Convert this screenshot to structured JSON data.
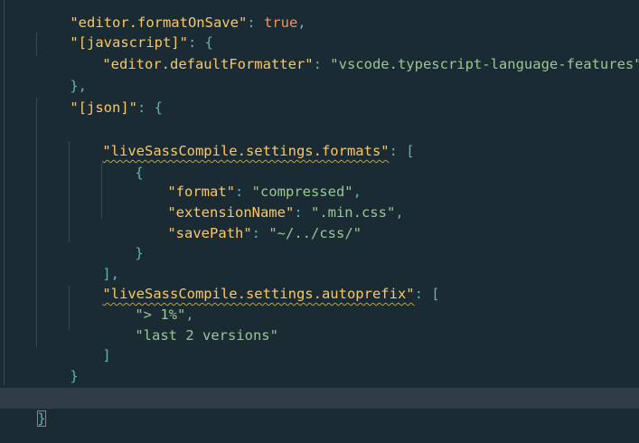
{
  "colors": {
    "background": "#1b2b34",
    "current_line": "#2f3d46",
    "key": "#fac863",
    "string": "#99c794",
    "punctuation": "#5fb3b3",
    "boolean": "#f99157",
    "warning_squiggle": "#c8a02a"
  },
  "lines": [
    {
      "k1": "\"editor.formatOnSave\"",
      "p1": ": ",
      "v1": "true",
      "p2": ","
    },
    {
      "k1": "\"[javascript]\"",
      "p1": ": {"
    },
    {
      "k1": "\"editor.defaultFormatter\"",
      "p1": ": ",
      "v1": "\"vscode.typescript-language-features\""
    },
    {
      "p1": "},"
    },
    {
      "k1": "\"[json]\"",
      "p1": ": {"
    },
    {
      "k1": "\"liveSassCompile.settings.formats\"",
      "p1": ": ["
    },
    {
      "p1": "{"
    },
    {
      "k1": "\"format\"",
      "p1": ": ",
      "v1": "\"compressed\"",
      "p2": ","
    },
    {
      "k1": "\"extensionName\"",
      "p1": ": ",
      "v1": "\".min.css\"",
      "p2": ","
    },
    {
      "k1": "\"savePath\"",
      "p1": ": ",
      "v1": "\"~/../css/\""
    },
    {
      "p1": "}"
    },
    {
      "p1": "],"
    },
    {
      "k1": "\"liveSassCompile.settings.autoprefix\"",
      "p1": ": ["
    },
    {
      "v1": "\"> 1%\"",
      "p2": ","
    },
    {
      "v1": "\"last 2 versions\""
    },
    {
      "p1": "]"
    },
    {
      "p1": "}"
    },
    {
      "p1": "}"
    }
  ]
}
